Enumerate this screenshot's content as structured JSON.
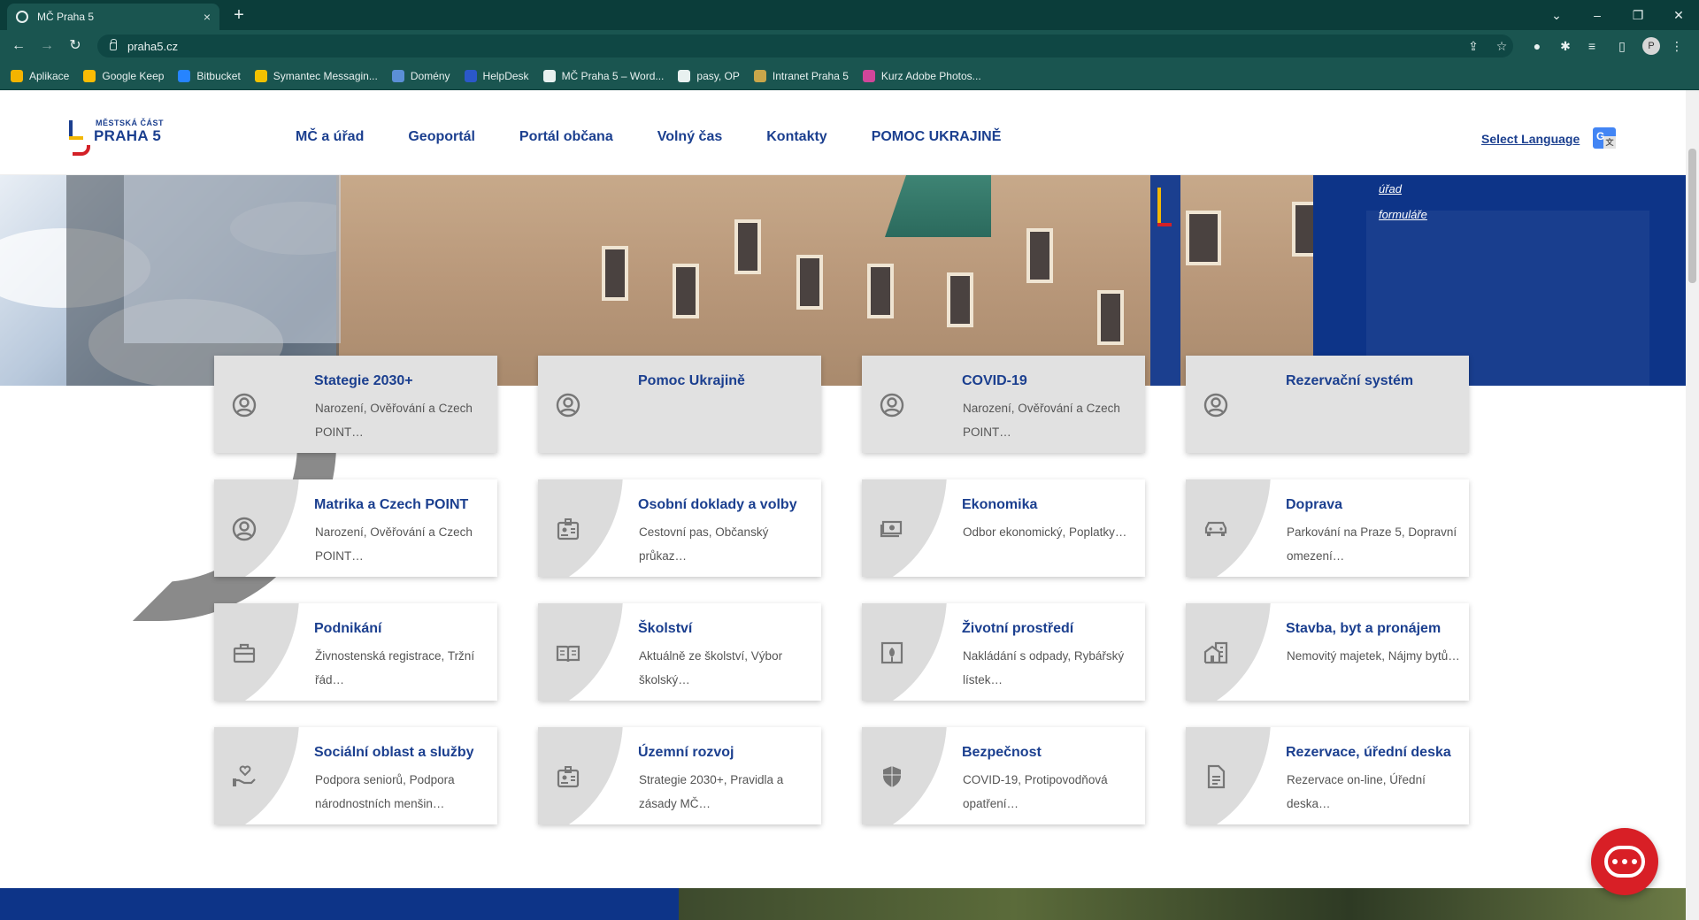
{
  "browser": {
    "tab_title": "MČ Praha 5",
    "tab_close": "×",
    "new_tab": "+",
    "url": "praha5.cz",
    "profile_initial": "P",
    "window_controls": [
      "⌄",
      "–",
      "❐",
      "✕"
    ],
    "bookmarks": [
      {
        "label": "Aplikace",
        "color": "#f4b400"
      },
      {
        "label": "Google Keep",
        "color": "#fbbc04"
      },
      {
        "label": "Bitbucket",
        "color": "#2684ff"
      },
      {
        "label": "Symantec Messagin...",
        "color": "#f2c200"
      },
      {
        "label": "Domény",
        "color": "#5b8fd6"
      },
      {
        "label": "HelpDesk",
        "color": "#2b58c9"
      },
      {
        "label": "MČ Praha 5 – Word...",
        "color": "#e8f1f0"
      },
      {
        "label": "pasy, OP",
        "color": "#e8f1f0"
      },
      {
        "label": "Intranet Praha 5",
        "color": "#c9a64a"
      },
      {
        "label": "Kurz Adobe Photos...",
        "color": "#d0469a"
      }
    ]
  },
  "header": {
    "logo_top": "MĚSTSKÁ ČÁST",
    "logo_main": "PRAHA 5",
    "nav": [
      "MČ a úřad",
      "Geoportál",
      "Portál občana",
      "Volný čas",
      "Kontakty",
      "POMOC UKRAJINĚ"
    ],
    "select_language": "Select Language",
    "translate_icon_letter": "G"
  },
  "hero": {
    "links": [
      "úřad",
      "formuláře"
    ]
  },
  "cards": [
    {
      "title": "Stategie 2030+",
      "desc": "Narození, Ověřování a Czech POINT…",
      "icon": "user-circle-icon",
      "style": "grey"
    },
    {
      "title": "Pomoc Ukrajině",
      "desc": "",
      "icon": "user-circle-icon",
      "style": "grey"
    },
    {
      "title": "COVID-19",
      "desc": "Narození, Ověřování a Czech POINT…",
      "icon": "user-circle-icon",
      "style": "grey"
    },
    {
      "title": "Rezervační systém",
      "desc": "",
      "icon": "user-circle-icon",
      "style": "grey"
    },
    {
      "title": "Matrika a Czech POINT",
      "desc": "Narození, Ověřování a Czech POINT…",
      "icon": "user-circle-icon",
      "style": "white"
    },
    {
      "title": "Osobní doklady a volby",
      "desc": "Cestovní pas, Občanský průkaz…",
      "icon": "id-badge-icon",
      "style": "white"
    },
    {
      "title": "Ekonomika",
      "desc": "Odbor ekonomický, Poplatky…",
      "icon": "money-icon",
      "style": "white"
    },
    {
      "title": "Doprava",
      "desc": "Parkování na Praze 5, Dopravní omezení…",
      "icon": "car-icon",
      "style": "white"
    },
    {
      "title": "Podnikání",
      "desc": "Živnostenská registrace, Tržní řád…",
      "icon": "briefcase-icon",
      "style": "white"
    },
    {
      "title": "Školství",
      "desc": "Aktuálně ze školství, Výbor školský…",
      "icon": "book-icon",
      "style": "white"
    },
    {
      "title": "Životní prostředí",
      "desc": "Nakládání s odpady, Rybářský lístek…",
      "icon": "eco-icon",
      "style": "white"
    },
    {
      "title": "Stavba, byt a pronájem",
      "desc": "Nemovitý majetek, Nájmy bytů…",
      "icon": "buildings-icon",
      "style": "white"
    },
    {
      "title": "Sociální oblast a služby",
      "desc": "Podpora seniorů, Podpora národnostních menšin…",
      "icon": "hand-heart-icon",
      "style": "white"
    },
    {
      "title": "Územní rozvoj",
      "desc": "Strategie 2030+, Pravidla a zásady MČ…",
      "icon": "id-badge-icon",
      "style": "white"
    },
    {
      "title": "Bezpečnost",
      "desc": "COVID-19, Protipovodňová opatření…",
      "icon": "shield-icon",
      "style": "white"
    },
    {
      "title": "Rezervace, úřední deska",
      "desc": "Rezervace on-line, Úřední deska…",
      "icon": "document-icon",
      "style": "white"
    }
  ],
  "colors": {
    "brand_blue": "#1b3f8f",
    "chrome_teal": "#1a5550",
    "chat_red": "#d81f26"
  }
}
